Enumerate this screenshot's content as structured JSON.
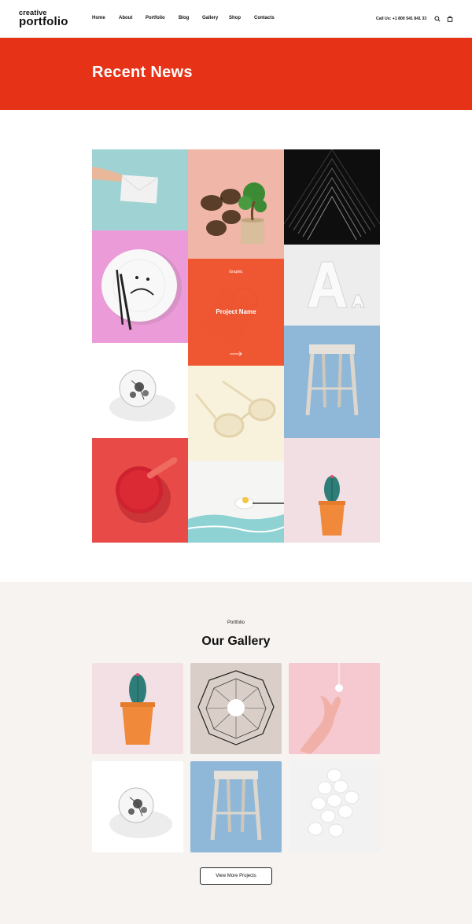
{
  "header": {
    "logo_top": "creative",
    "logo_bottom": "portfolio",
    "nav": [
      "Home",
      "About",
      "Portfolio",
      "Blog",
      "Gallery",
      "Shop",
      "Contacts"
    ],
    "call": "Call Us: +1 800 541 841 33",
    "icons": [
      "search-icon",
      "shopping-bag-icon"
    ]
  },
  "banner": {
    "title": "Recent News",
    "color": "#e63318"
  },
  "portfolio_grid": {
    "overlay": {
      "category": "Graphic",
      "name": "Project Name",
      "icon": "arrow-right-icon"
    }
  },
  "gallery": {
    "eyebrow": "Portfolio",
    "title": "Our Gallery",
    "button": "View More Projects"
  }
}
